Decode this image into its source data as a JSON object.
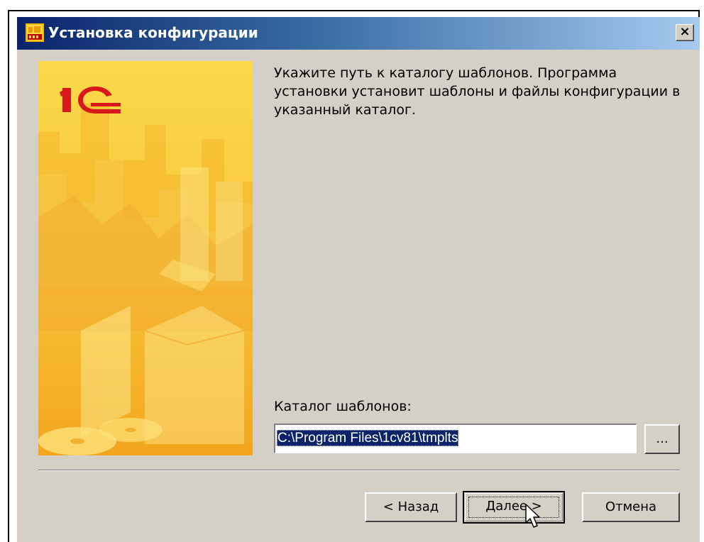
{
  "window": {
    "title": "Установка конфигурации",
    "close_label": "×"
  },
  "banner": {
    "logo_text": "1С"
  },
  "main": {
    "instruction": "Укажите путь к каталогу шаблонов. Программа установки установит шаблоны и файлы конфигурации в указанный каталог.",
    "field_label": "Каталог шаблонов:",
    "path_value": "C:\\Program Files\\1cv81\\tmplts",
    "browse_label": "..."
  },
  "footer": {
    "back_label": "< Назад",
    "next_label": "Далее >",
    "cancel_label": "Отмена"
  },
  "icons": {
    "app": "1c-app-icon",
    "close": "close-icon",
    "cursor": "mouse-pointer-icon"
  },
  "colors": {
    "titlebar_start": "#0a246a",
    "titlebar_end": "#a6caf0",
    "dialog_bg": "#d4d0c8",
    "selection": "#0a246a",
    "banner_yellow": "#f7c52e",
    "logo_red": "#d7191c"
  }
}
